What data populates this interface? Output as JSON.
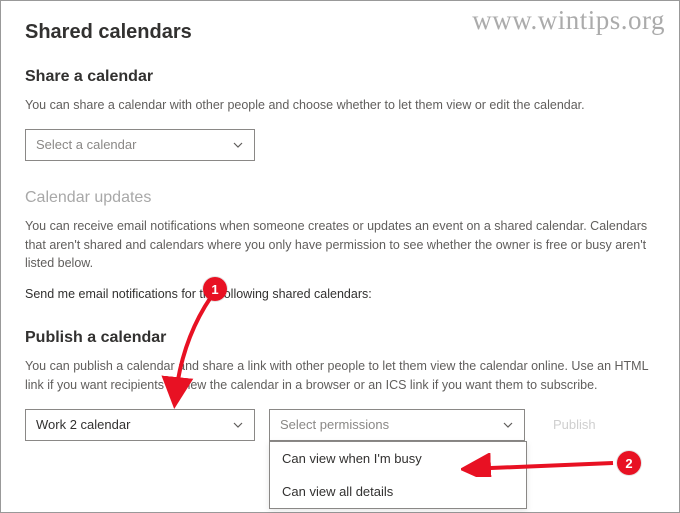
{
  "watermark": "www.wintips.org",
  "page_title": "Shared calendars",
  "share": {
    "title": "Share a calendar",
    "desc": "You can share a calendar with other people and choose whether to let them view or edit the calendar.",
    "select_placeholder": "Select a calendar"
  },
  "updates": {
    "title": "Calendar updates",
    "desc": "You can receive email notifications when someone creates or updates an event on a shared calendar. Calendars that aren't shared and calendars where you only have permission to see whether the owner is free or busy aren't listed below.",
    "instruction": "Send me email notifications for the following shared calendars:"
  },
  "publish": {
    "title": "Publish a calendar",
    "desc": "You can publish a calendar and share a link with other people to let them view the calendar online. Use an HTML link if you want recipients to view the calendar in a browser or an ICS link if you want them to subscribe.",
    "calendar_value": "Work 2 calendar",
    "permissions_placeholder": "Select permissions",
    "options": {
      "busy": "Can view when I'm busy",
      "all": "Can view all details"
    },
    "publish_label": "Publish"
  },
  "annotations": {
    "badge1": "1",
    "badge2": "2"
  }
}
